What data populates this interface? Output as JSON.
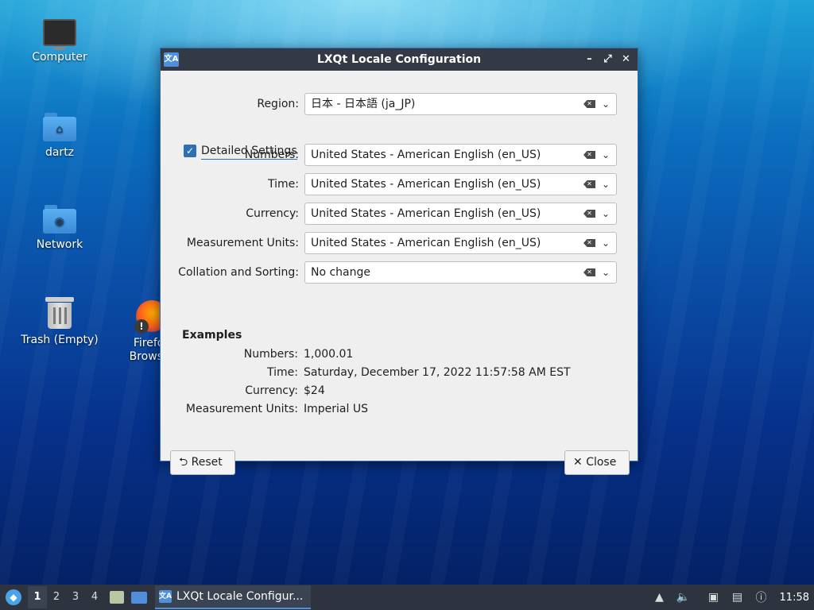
{
  "desktop": {
    "icons": [
      {
        "label": "Computer"
      },
      {
        "label": "dartz"
      },
      {
        "label": "Network"
      },
      {
        "label": "Trash (Empty)"
      },
      {
        "label": "Firefox Browser"
      }
    ]
  },
  "window": {
    "title": "LXQt Locale Configuration",
    "region": {
      "label": "Region:",
      "value": "日本 - 日本語 (ja_JP)"
    },
    "detailed": {
      "label": "Detailed Settings",
      "checked": true
    },
    "settings": [
      {
        "label": "Numbers:",
        "value": "United States - American English (en_US)"
      },
      {
        "label": "Time:",
        "value": "United States - American English (en_US)"
      },
      {
        "label": "Currency:",
        "value": "United States - American English (en_US)"
      },
      {
        "label": "Measurement Units:",
        "value": "United States - American English (en_US)"
      },
      {
        "label": "Collation and Sorting:",
        "value": "No change"
      }
    ],
    "examples": {
      "title": "Examples",
      "items": [
        {
          "label": "Numbers:",
          "value": "1,000.01"
        },
        {
          "label": "Time:",
          "value": "Saturday, December 17, 2022 11:57:58 AM EST"
        },
        {
          "label": "Currency:",
          "value": "$24"
        },
        {
          "label": "Measurement Units:",
          "value": "Imperial US"
        }
      ]
    },
    "buttons": {
      "reset": "Reset",
      "close": "Close"
    }
  },
  "taskbar": {
    "desktops": [
      "1",
      "2",
      "3",
      "4"
    ],
    "active_desktop": "1",
    "task_label": "LXQt Locale Configur...",
    "clock": "11:58"
  }
}
